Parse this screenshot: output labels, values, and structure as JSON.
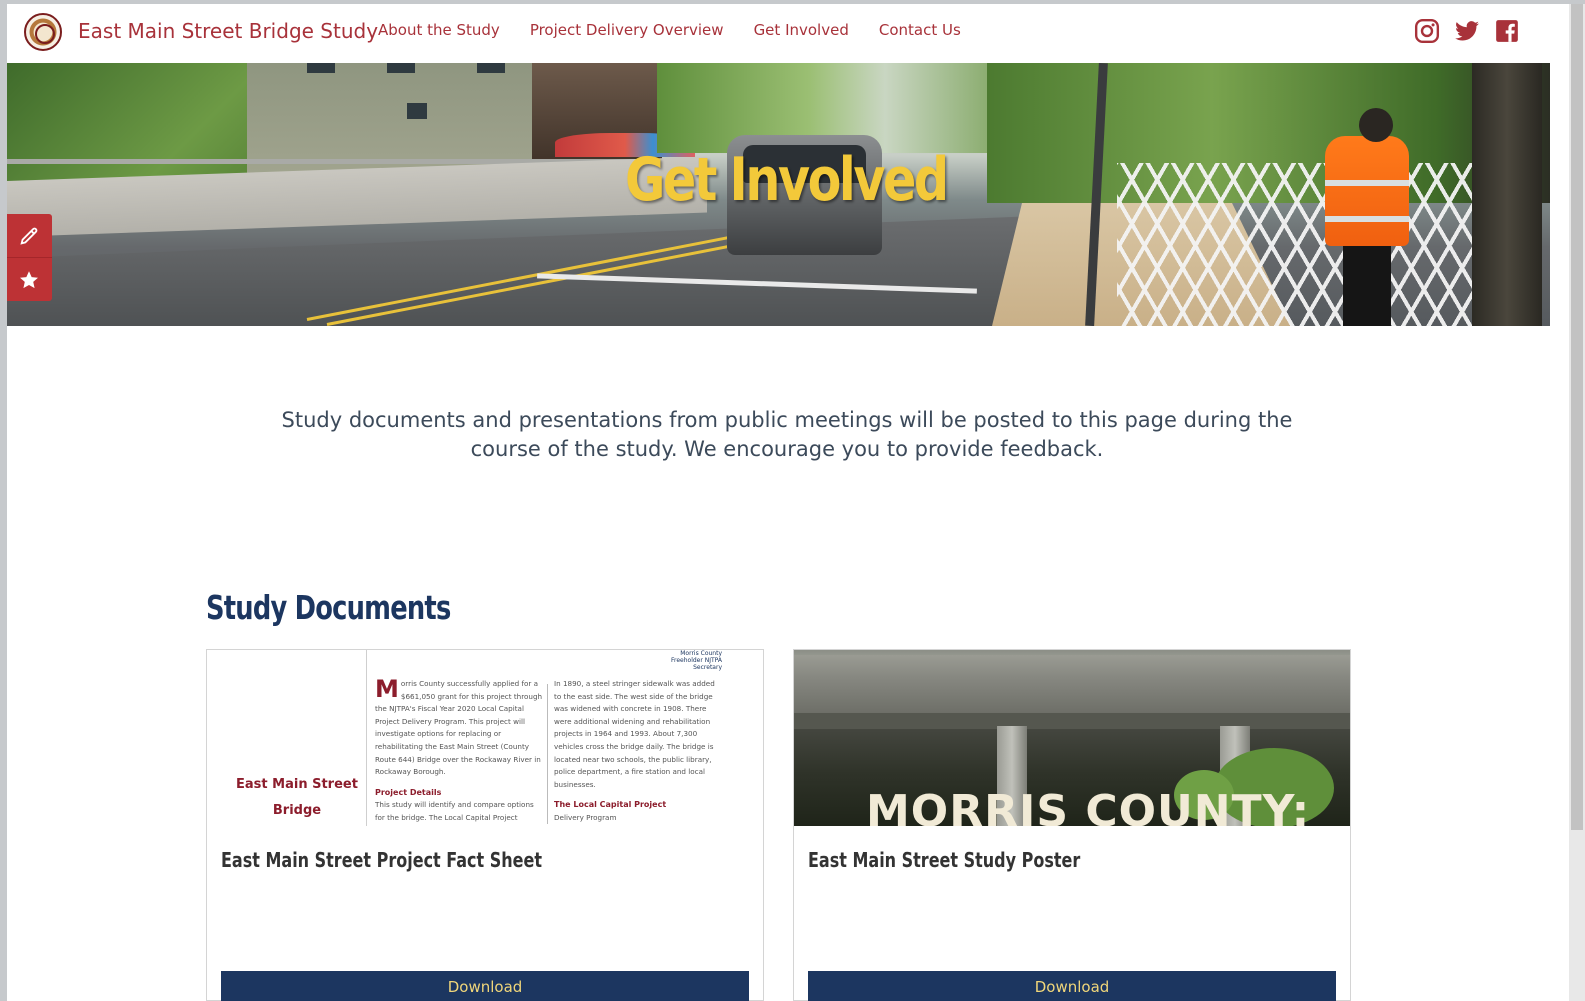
{
  "header": {
    "site_title": "East Main Street Bridge Study",
    "nav": [
      "About the Study",
      "Project Delivery Overview",
      "Get Involved",
      "Contact Us"
    ],
    "social_icons": [
      "instagram-icon",
      "twitter-icon",
      "facebook-icon"
    ],
    "accent_color": "#a8323a"
  },
  "hero": {
    "title": "Get Involved",
    "title_color": "#f3c93a"
  },
  "side_tools": [
    "pencil-icon",
    "star-icon"
  ],
  "intro": {
    "text": "Study documents and presentations from public meetings will be posted to this page during the course of the study. We encourage you to provide feedback."
  },
  "documents": {
    "section_title": "Study Documents",
    "items": [
      {
        "name": "East Main Street Project Fact Sheet",
        "button": "Download",
        "thumb": {
          "title_line1": "East Main Street",
          "title_line2": "Bridge",
          "top_right": "Morris County Freeholder NJTPA Secretary",
          "col1_drop": "M",
          "col1_text": "orris County successfully applied for a $661,050 grant for this project through the NJTPA's Fiscal Year 2020 Local Capital Project Delivery Program. This project will investigate options for replacing or rehabilitating the East Main Street (County Route 644) Bridge over the Rockaway River in Rockaway Borough.",
          "col1_heading": "Project Details",
          "col1_text2": "This study will identify and compare options for the bridge. The Local Capital Project Delivery",
          "col2_text": "In 1890, a steel stringer sidewalk was added to the east side. The west side of the bridge was widened with concrete in 1908. There were additional widening and rehabilitation projects in 1964 and 1993. About 7,300 vehicles cross the bridge daily. The bridge is located near two schools, the public library, police department, a fire station and local businesses.",
          "col2_heading": "The Local Capital Project",
          "col2_text2": "Delivery Program"
        }
      },
      {
        "name": "East Main Street Study Poster",
        "button": "Download",
        "thumb": {
          "overlay_text": "MORRIS COUNTY:"
        }
      }
    ],
    "button_bg": "#1c3660",
    "button_text_color": "#f0d67a"
  }
}
